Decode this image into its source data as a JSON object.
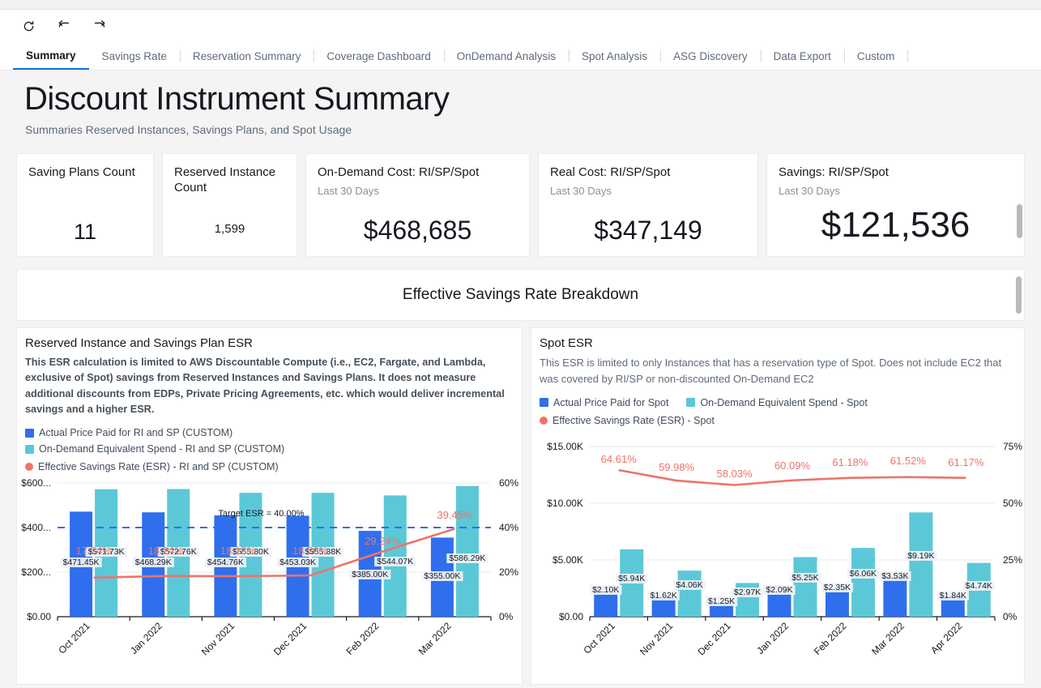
{
  "toolbar": {
    "icons": [
      {
        "name": "refresh-icon",
        "label": "Refresh"
      },
      {
        "name": "undo-icon",
        "label": "Undo"
      },
      {
        "name": "redo-icon",
        "label": "Redo"
      }
    ]
  },
  "tabs": [
    {
      "label": "Summary",
      "active": true
    },
    {
      "label": "Savings Rate",
      "active": false
    },
    {
      "label": "Reservation Summary",
      "active": false
    },
    {
      "label": "Coverage Dashboard",
      "active": false
    },
    {
      "label": "OnDemand Analysis",
      "active": false
    },
    {
      "label": "Spot Analysis",
      "active": false
    },
    {
      "label": "ASG Discovery",
      "active": false
    },
    {
      "label": "Data Export",
      "active": false
    },
    {
      "label": "Custom",
      "active": false
    }
  ],
  "header": {
    "title": "Discount Instrument Summary",
    "subtitle": "Summaries Reserved Instances, Savings Plans, and Spot Usage"
  },
  "kpis": [
    {
      "title": "Saving Plans Count",
      "sub": "",
      "value": "11"
    },
    {
      "title": "Reserved Instance Count",
      "sub": "",
      "value": "1,599"
    },
    {
      "title": "On-Demand Cost: RI/SP/Spot",
      "sub": "Last 30 Days",
      "value": "$468,685"
    },
    {
      "title": "Real Cost: RI/SP/Spot",
      "sub": "Last 30 Days",
      "value": "$347,149"
    },
    {
      "title": "Savings: RI/SP/Spot",
      "sub": "Last 30 Days",
      "value": "$121,536"
    }
  ],
  "banner": {
    "title": "Effective Savings Rate Breakdown"
  },
  "colors": {
    "actual_blue": "#2f6fed",
    "ondemand_teal": "#5bc8d8",
    "esr_red": "#f0726a",
    "target_dash": "#2f6fed",
    "accent": "#0972d3"
  },
  "panels": {
    "left": {
      "title": "Reserved Instance and Savings Plan ESR",
      "description": "This ESR calculation is limited to AWS Discountable Compute (i.e., EC2, Fargate, and Lambda, exclusive of Spot) savings from Reserved Instances and Savings Plans. It does not measure additional discounts from EDPs, Private Pricing Agreements, etc. which would deliver incremental savings and a higher ESR.",
      "legend": [
        {
          "label": "Actual Price Paid for RI and SP (CUSTOM)",
          "color": "#2f6fed",
          "shape": "square"
        },
        {
          "label": "On-Demand Equivalent Spend - RI and SP (CUSTOM)",
          "color": "#5bc8d8",
          "shape": "square"
        },
        {
          "label": "Effective Savings Rate (ESR) - RI and SP (CUSTOM)",
          "color": "#f0726a",
          "shape": "dot"
        }
      ]
    },
    "right": {
      "title": "Spot ESR",
      "description": "This ESR is limited to only Instances that has a reservation type of Spot. Does not include EC2 that was covered by RI/SP or non-discounted On-Demand EC2",
      "legend": [
        {
          "label": "Actual Price Paid for Spot",
          "color": "#2f6fed",
          "shape": "square"
        },
        {
          "label": "On-Demand Equivalent Spend - Spot",
          "color": "#5bc8d8",
          "shape": "square"
        },
        {
          "label": "Effective Savings Rate (ESR) - Spot",
          "color": "#f0726a",
          "shape": "dot"
        }
      ]
    }
  },
  "chart_data": [
    {
      "id": "ri_sp_esr",
      "type": "bar",
      "title": "Reserved Instance and Savings Plan ESR",
      "categories": [
        "Oct 2021",
        "Jan 2022",
        "Nov 2021",
        "Dec 2021",
        "Feb 2022",
        "Mar 2022"
      ],
      "series": [
        {
          "name": "Actual Price Paid for RI and SP (CUSTOM)",
          "color": "#2f6fed",
          "values": [
            471450,
            468290,
            454760,
            453030,
            385000,
            355000
          ],
          "labels": [
            "$471.45K",
            "$468.29K",
            "$454.76K",
            "$453.03K",
            "$385.00K",
            "$355.00K"
          ]
        },
        {
          "name": "On-Demand Equivalent Spend - RI and SP (CUSTOM)",
          "color": "#5bc8d8",
          "values": [
            571730,
            572760,
            555800,
            555880,
            544070,
            586290
          ],
          "labels": [
            "$571.73K",
            "$572.76K",
            "$555.80K",
            "$555.88K",
            "$544.07K",
            "$586.29K"
          ]
        }
      ],
      "line_series": {
        "name": "Effective Savings Rate (ESR) - RI and SP (CUSTOM)",
        "color": "#f0726a",
        "values": [
          17.54,
          18.24,
          18.18,
          18.5,
          29.24,
          39.45
        ],
        "labels": [
          "17.54%",
          "18.24%",
          "18.18%",
          "18.50%",
          "29.24%",
          "39.45%"
        ]
      },
      "target_line": {
        "label": "Target ESR =  40.00%",
        "value": 40.0,
        "color": "#2f6fed",
        "style": "dashed"
      },
      "ylabel": "",
      "ylim": [
        0,
        600000
      ],
      "yticks": [
        "$0.00",
        "$200...",
        "$400...",
        "$600..."
      ],
      "y2lim": [
        0,
        60
      ],
      "y2ticks": [
        "0%",
        "20%",
        "40%",
        "60%"
      ],
      "xlabel": "",
      "grid": true,
      "legend_position": "top"
    },
    {
      "id": "spot_esr",
      "type": "bar",
      "title": "Spot ESR",
      "categories": [
        "Oct 2021",
        "Nov 2021",
        "Dec 2021",
        "Jan 2022",
        "Feb 2022",
        "Mar 2022",
        "Apr 2022"
      ],
      "series": [
        {
          "name": "Actual Price Paid for Spot",
          "color": "#2f6fed",
          "values": [
            2100,
            1620,
            1250,
            2090,
            2350,
            3530,
            1840
          ],
          "labels": [
            "$2.10K",
            "$1.62K",
            "$1.25K",
            "$2.09K",
            "$2.35K",
            "$3.53K",
            "$1.84K"
          ]
        },
        {
          "name": "On-Demand Equivalent Spend - Spot",
          "color": "#5bc8d8",
          "values": [
            5940,
            4060,
            2970,
            5250,
            6060,
            9190,
            4740
          ],
          "labels": [
            "$5.94K",
            "$4.06K",
            "$2.97K",
            "$5.25K",
            "$6.06K",
            "$9.19K",
            "$4.74K"
          ]
        }
      ],
      "line_series": {
        "name": "Effective Savings Rate (ESR) - Spot",
        "color": "#f0726a",
        "values": [
          64.61,
          59.98,
          58.03,
          60.09,
          61.18,
          61.52,
          61.17
        ],
        "labels": [
          "64.61%",
          "59.98%",
          "58.03%",
          "60.09%",
          "61.18%",
          "61.52%",
          "61.17%"
        ]
      },
      "ylabel": "",
      "ylim": [
        0,
        15000
      ],
      "yticks": [
        "$0.00",
        "$5.00K",
        "$10.00K",
        "$15.00K"
      ],
      "y2lim": [
        0,
        75
      ],
      "y2ticks": [
        "0%",
        "25%",
        "50%",
        "75%"
      ],
      "xlabel": "",
      "grid": true,
      "legend_position": "top"
    }
  ]
}
